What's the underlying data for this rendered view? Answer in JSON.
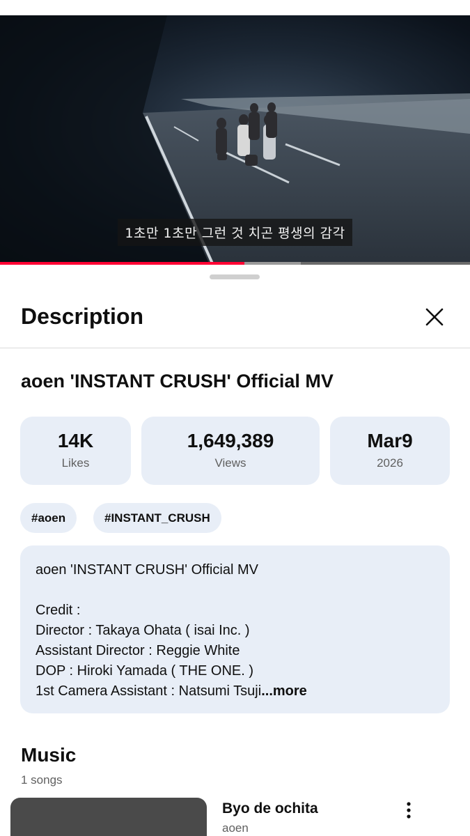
{
  "video": {
    "subtitle": "1초만   1초만   그런 것 치곤 평생의 감각",
    "progress_fraction": 0.52,
    "buffer_end_fraction": 0.64
  },
  "sheet": {
    "title": "Description",
    "close_icon": "close-icon"
  },
  "video_info": {
    "title": "aoen 'INSTANT CRUSH' Official MV",
    "stats": [
      {
        "value": "14K",
        "label": "Likes"
      },
      {
        "value": "1,649,389",
        "label": "Views"
      },
      {
        "value": "Mar9",
        "label": "2026"
      }
    ],
    "tags": [
      "#aoen",
      "#INSTANT_CRUSH"
    ]
  },
  "description": {
    "line1": "aoen 'INSTANT CRUSH' Official MV",
    "line2": "Credit :",
    "line3": "Director : Takaya Ohata ( isai Inc. )",
    "line4": "Assistant Director : Reggie White",
    "line5": "DOP : Hiroki Yamada ( THE ONE. )",
    "line6": "1st Camera Assistant : Natsumi Tsuji",
    "more_label": "...more"
  },
  "music": {
    "title": "Music",
    "count": "1 songs",
    "songs": [
      {
        "name": "Byo de ochita",
        "artist": "aoen",
        "menu_icon": "more-vertical-icon"
      }
    ]
  },
  "colors": {
    "accent": "#ff0033",
    "card_bg": "#e8eef7",
    "secondary_text": "#606060"
  }
}
